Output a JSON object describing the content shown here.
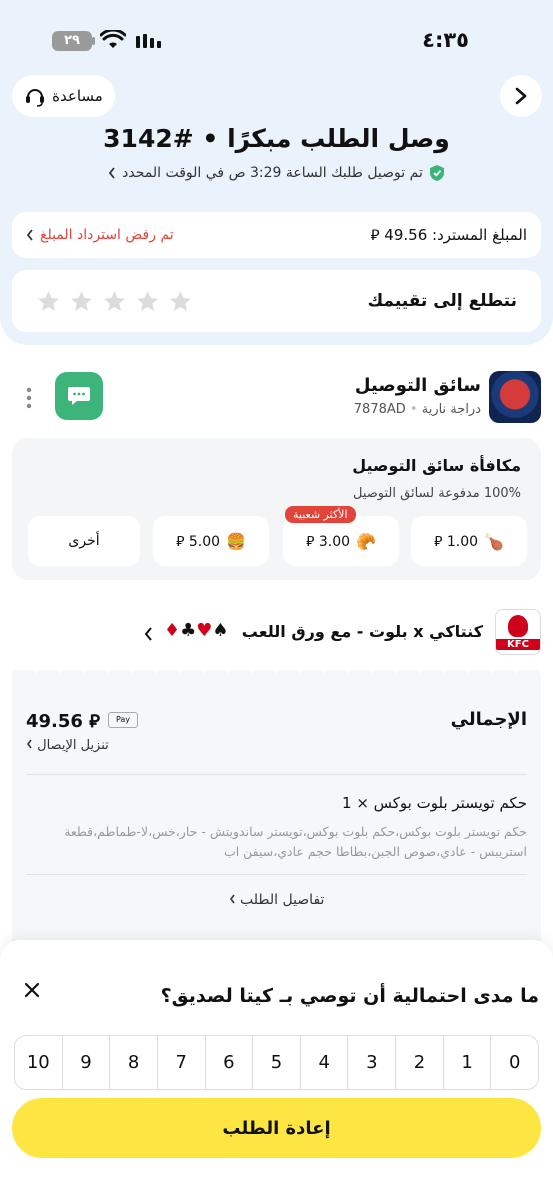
{
  "status_bar": {
    "time": "٤:٣٥",
    "battery": "٢٩"
  },
  "header": {
    "help_label": "مساعدة",
    "title": "وصل الطلب مبكرًا • #3142",
    "delivery_note": "تم توصيل طلبك الساعة 3:29 ص في الوقت المحدد"
  },
  "refund": {
    "amount_label": "المبلغ المسترد: 49.56 ⃁",
    "status": "تم رفض استرداد المبلغ"
  },
  "rating": {
    "prompt": "نتطلع إلى تقييمك",
    "max_stars": 5,
    "filled": 0
  },
  "courier": {
    "title": "سائق التوصيل",
    "vehicle": "دراجة نارية",
    "plate": "7878AD"
  },
  "tip": {
    "title": "مكافأة سائق التوصيل",
    "subtitle": "100% مدفوعة لسائق التوصيل",
    "options": [
      {
        "label": "1.00 ⃁",
        "icon": "drumstick-icon"
      },
      {
        "label": "3.00 ⃁",
        "icon": "croissant-icon",
        "badge": "الأكثر شعبية"
      },
      {
        "label": "5.00 ⃁",
        "icon": "burger-icon"
      },
      {
        "label": "أخرى"
      }
    ]
  },
  "store": {
    "name": "كنتاكي x بلوت - مع ورق اللعب",
    "suits": "♠♥♣♦",
    "logo_text": "KFC"
  },
  "receipt": {
    "total_label": "الإجمالي",
    "total_amount": "49.56 ⃁",
    "payment_method": "Pay",
    "invoice_link": "تنزيل الإيصال",
    "item_title": "حكم تويستر بلوت بوكس × 1",
    "item_desc": "حكم تويستر بلوت بوكس،حكم بلوت بوكس،تويستر ساندويتش - حار،خس،لا-طماطم،قطعة استريبس - عادي،صوص الجبن،بطاطا حجم عادي،سيفن اب",
    "details_link": "تفاصيل الطلب"
  },
  "nps": {
    "question": "ما مدى احتمالية أن توصي بـ كيتا لصديق؟",
    "scale": [
      "10",
      "9",
      "8",
      "7",
      "6",
      "5",
      "4",
      "3",
      "2",
      "1",
      "0"
    ]
  },
  "reorder_label": "إعادة الطلب",
  "colors": {
    "accent_yellow": "#fde642",
    "chat_green": "#3db57a",
    "error_red": "#e0443a",
    "header_bg": "#eaf2fb"
  }
}
